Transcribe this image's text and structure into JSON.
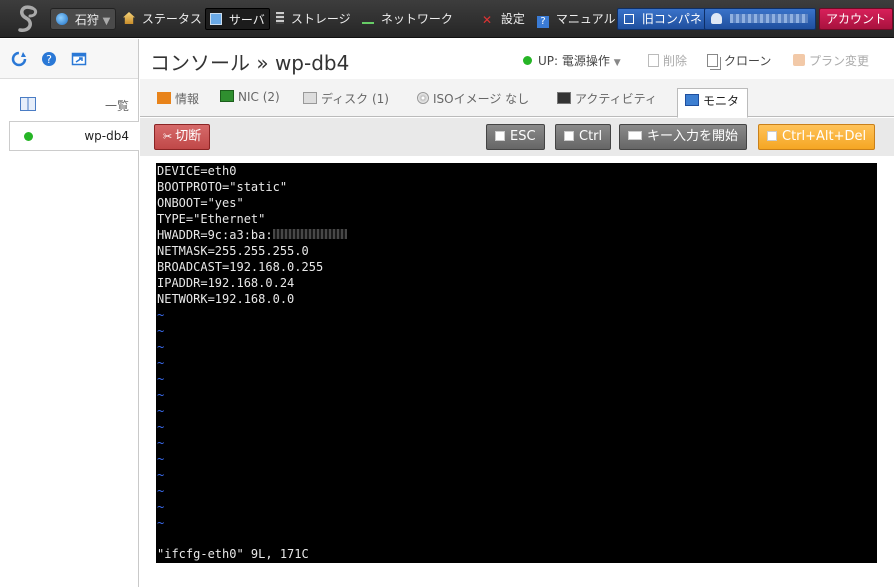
{
  "topbar": {
    "region": "石狩",
    "nav": [
      {
        "label": "ステータス"
      },
      {
        "label": "サーバ"
      },
      {
        "label": "ストレージ"
      },
      {
        "label": "ネットワーク"
      },
      {
        "label": "設定"
      },
      {
        "label": "マニュアル"
      }
    ],
    "old_control_panel": "旧コンパネ",
    "account": "アカウント"
  },
  "sidebar": {
    "list_label": "一覧",
    "servers": [
      {
        "name": "wp-db4",
        "status": "up"
      }
    ]
  },
  "header": {
    "title": "コンソール » wp-db4",
    "status": "UP: 電源操作",
    "delete": "削除",
    "clone": "クローン",
    "plan_change": "プラン変更"
  },
  "tabs": [
    {
      "label": "情報"
    },
    {
      "label": "NIC (2)"
    },
    {
      "label": "ディスク (1)"
    },
    {
      "label": "ISOイメージ なし"
    },
    {
      "label": "アクティビティ"
    },
    {
      "label": "モニタ",
      "active": true
    }
  ],
  "toolbar": {
    "disconnect": "切断",
    "esc": "ESC",
    "ctrl": "Ctrl",
    "key_input": "キー入力を開始",
    "cad": "Ctrl+Alt+Del"
  },
  "console": {
    "lines": [
      "DEVICE=eth0",
      "BOOTPROTO=\"static\"",
      "ONBOOT=\"yes\"",
      "TYPE=\"Ethernet\"",
      "HWADDR=9c:a3:ba:",
      "NETMASK=255.255.255.0",
      "BROADCAST=192.168.0.255",
      "IPADDR=192.168.0.24",
      "NETWORK=192.168.0.0"
    ],
    "tilde": "~",
    "status_line": "\"ifcfg-eth0\" 9L, 171C"
  },
  "colors": {
    "status_up": "#26b526",
    "accent_blue": "#2a62b8",
    "account_red": "#c4184c",
    "tilde_blue": "#3b6cf0"
  }
}
